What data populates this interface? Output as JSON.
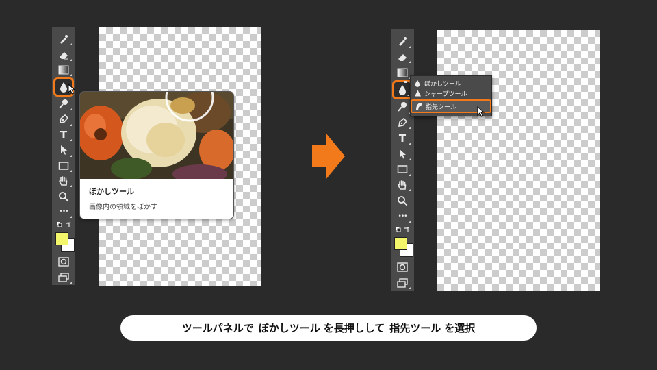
{
  "colors": {
    "background": "#2a2a2a",
    "toolbar": "#4a4a4a",
    "highlight": "#f27a1a",
    "foreground_swatch": "#f3f56a",
    "background_swatch": "#ffffff"
  },
  "toolbar_icons": [
    "healing-brush-icon",
    "eraser-icon",
    "gradient-icon",
    "blur-icon",
    "dodge-icon",
    "pen-icon",
    "type-icon",
    "path-selection-icon",
    "rectangle-icon",
    "hand-icon",
    "zoom-icon",
    "more-icon"
  ],
  "toolbar": {
    "type_glyph": "T",
    "more_glyph": "•••"
  },
  "tooltip": {
    "title": "ぼかしツール",
    "description": "画像内の領域をぼかす"
  },
  "flyout": {
    "items": [
      {
        "label": "ぼかしツール",
        "icon": "blur-icon"
      },
      {
        "label": "シャープツール",
        "icon": "sharpen-icon"
      },
      {
        "label": "指先ツール",
        "icon": "smudge-icon"
      }
    ]
  },
  "caption": {
    "part1": "ツールパネルで",
    "part2": "ぼかしツール",
    "part3": "を長押しして",
    "part4": "指先ツール",
    "part5": "を選択"
  }
}
